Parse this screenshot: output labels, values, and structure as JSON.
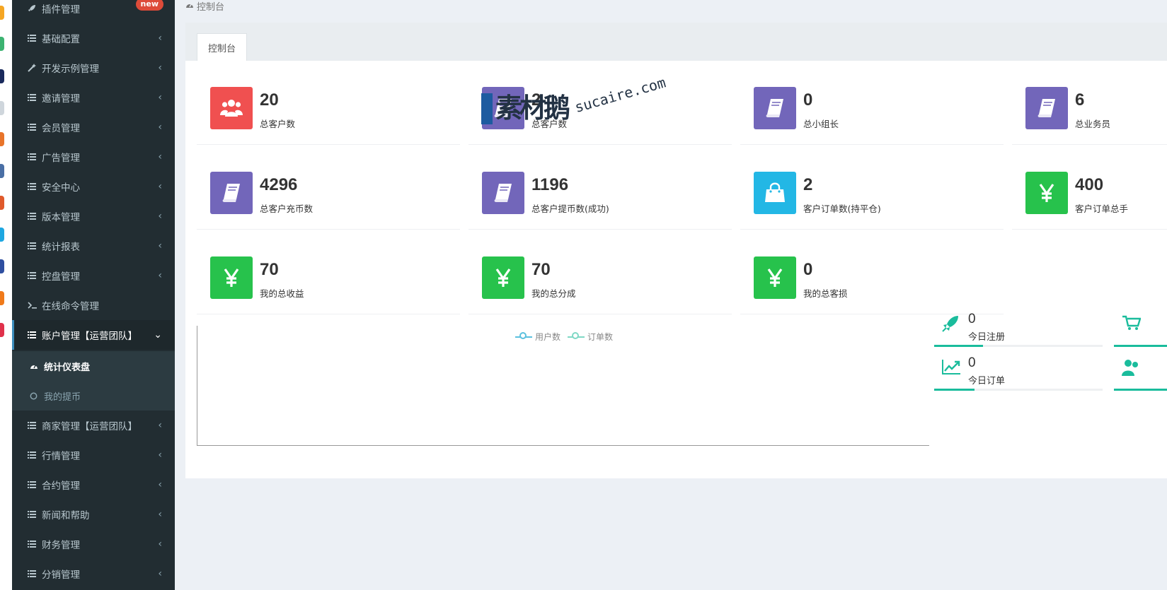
{
  "sidebar": {
    "items": [
      {
        "label": "插件管理",
        "icon": "rocket-icon",
        "badge": "new"
      },
      {
        "label": "基础配置",
        "icon": "list-icon"
      },
      {
        "label": "开发示例管理",
        "icon": "magic-wand-icon"
      },
      {
        "label": "邀请管理",
        "icon": "list-icon"
      },
      {
        "label": "会员管理",
        "icon": "list-icon"
      },
      {
        "label": "广告管理",
        "icon": "list-icon"
      },
      {
        "label": "安全中心",
        "icon": "list-icon"
      },
      {
        "label": "版本管理",
        "icon": "list-icon"
      },
      {
        "label": "统计报表",
        "icon": "list-icon"
      },
      {
        "label": "控盘管理",
        "icon": "list-icon"
      },
      {
        "label": "在线命令管理",
        "icon": "terminal-icon"
      },
      {
        "label": "账户管理【运营团队】",
        "icon": "list-icon",
        "expanded": true
      },
      {
        "label": "商家管理【运营团队】",
        "icon": "list-icon"
      },
      {
        "label": "行情管理",
        "icon": "list-icon"
      },
      {
        "label": "合约管理",
        "icon": "list-icon"
      },
      {
        "label": "新闻和帮助",
        "icon": "list-icon"
      },
      {
        "label": "财务管理",
        "icon": "list-icon"
      },
      {
        "label": "分销管理",
        "icon": "list-icon"
      }
    ],
    "submenu": [
      {
        "label": "统计仪表盘",
        "icon": "dashboard-icon",
        "current": true
      },
      {
        "label": "我的提币",
        "icon": "circle-icon"
      }
    ]
  },
  "breadcrumb": {
    "label": "控制台",
    "icon": "dashboard-icon"
  },
  "tabs": [
    {
      "label": "控制台"
    }
  ],
  "stats": [
    {
      "value": "20",
      "label": "总客户数",
      "color": "#f05050",
      "icon": "users-icon"
    },
    {
      "value": "2",
      "label": "总客户数",
      "color": "#7266ba",
      "icon": "book-icon"
    },
    {
      "value": "0",
      "label": "总小组长",
      "color": "#7266ba",
      "icon": "book-icon"
    },
    {
      "value": "6",
      "label": "总业务员",
      "color": "#7266ba",
      "icon": "book-icon"
    },
    {
      "value": "4296",
      "label": "总客户充币数",
      "color": "#7266ba",
      "icon": "book-icon"
    },
    {
      "value": "1196",
      "label": "总客户提币数(成功)",
      "color": "#7266ba",
      "icon": "book-icon"
    },
    {
      "value": "2",
      "label": "客户订单数(持平仓)",
      "color": "#23b7e5",
      "icon": "shopping-bag-icon"
    },
    {
      "value": "400",
      "label": "客户订单总手",
      "color": "#27c24c",
      "icon": "yen-icon"
    },
    {
      "value": "70",
      "label": "我的总收益",
      "color": "#27c24c",
      "icon": "yen-icon"
    },
    {
      "value": "70",
      "label": "我的总分成",
      "color": "#27c24c",
      "icon": "yen-icon"
    },
    {
      "value": "0",
      "label": "我的总客损",
      "color": "#27c24c",
      "icon": "yen-icon"
    }
  ],
  "chart": {
    "legend": [
      {
        "name": "用户数",
        "color": "#5bc0de"
      },
      {
        "name": "订单数",
        "color": "#7fd8c5"
      }
    ]
  },
  "today": [
    {
      "value": "0",
      "label": "今日注册",
      "icon": "rocket-icon",
      "progress": 0.3
    },
    {
      "value": "0",
      "label": "今日订单",
      "icon": "line-chart-icon",
      "progress": 0.25
    }
  ],
  "watermark": {
    "zh": "素材鹅",
    "en": "sucaire.com"
  },
  "colors": {
    "sidebar_bg": "#222d32",
    "sidebar_active_border": "#3c8dbc",
    "accent_green": "#1abc9c",
    "badge_red": "#dd4b39"
  }
}
